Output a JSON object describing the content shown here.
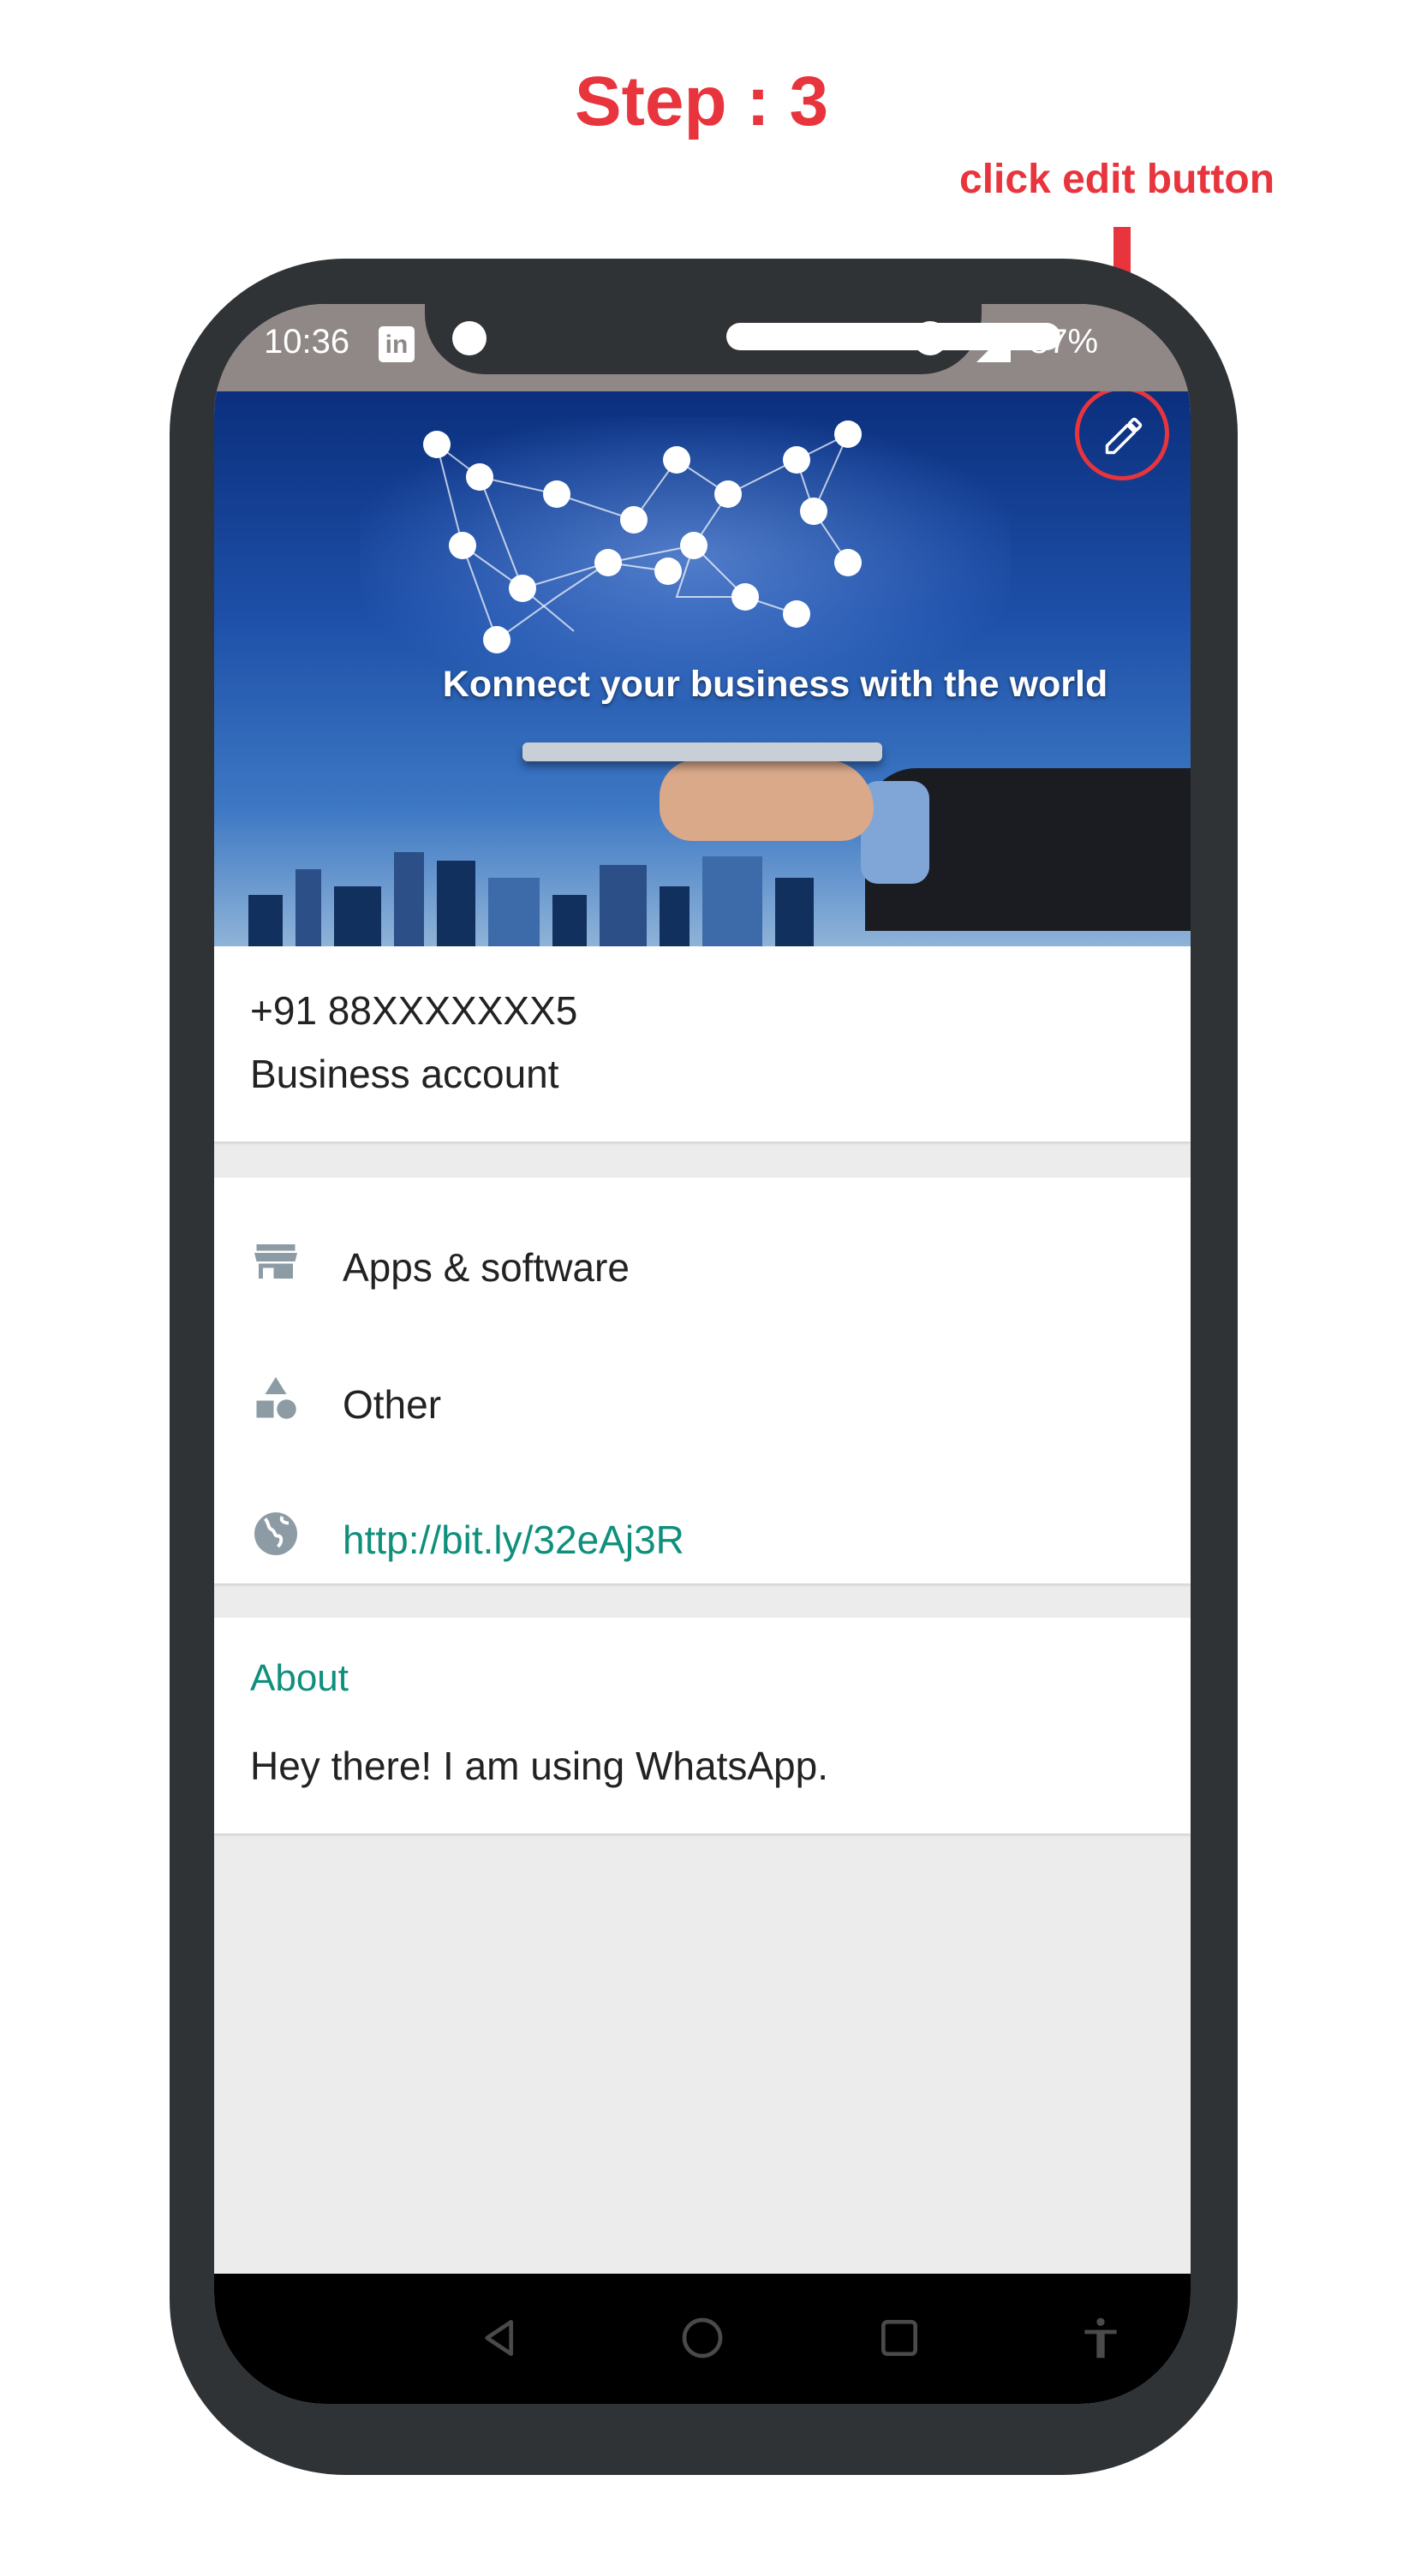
{
  "annotation": {
    "step_title": "Step : 3",
    "hint": "click edit button",
    "accent_color": "#e8343c"
  },
  "status_bar": {
    "time": "10:36",
    "app_icon": "linkedin-icon",
    "app_icon_text": "in",
    "battery": "87%",
    "signal_icon": "signal-icon"
  },
  "header": {
    "banner_caption": "Konnect your business with the world",
    "edit_icon": "pencil-icon"
  },
  "profile": {
    "phone_number": "+91 88XXXXXXX5",
    "account_type": "Business account"
  },
  "details": {
    "items": [
      {
        "icon": "store-icon",
        "label": "Apps & software"
      },
      {
        "icon": "category-shapes-icon",
        "label": "Other"
      },
      {
        "icon": "globe-icon",
        "label": "http://bit.ly/32eAj3R"
      }
    ],
    "link_color": "#0f8f7c"
  },
  "about": {
    "label": "About",
    "text": "Hey there! I am using WhatsApp."
  },
  "nav_bar": {
    "buttons": [
      "back-icon",
      "home-icon",
      "recents-icon",
      "accessibility-icon"
    ]
  }
}
